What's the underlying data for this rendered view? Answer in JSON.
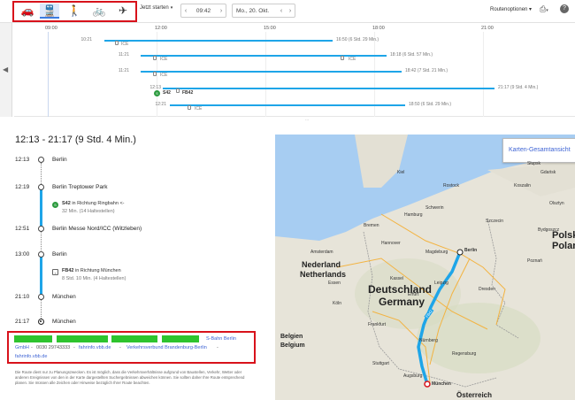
{
  "modes": [
    {
      "icon": "car-icon",
      "glyph": "🚗",
      "active": false
    },
    {
      "icon": "transit-icon",
      "glyph": "🚆",
      "active": true
    },
    {
      "icon": "walk-icon",
      "glyph": "🚶",
      "active": false
    },
    {
      "icon": "bicycle-icon",
      "glyph": "🚲",
      "active": false
    },
    {
      "icon": "flight-icon",
      "glyph": "✈",
      "active": false
    }
  ],
  "toolbar": {
    "depart_label": "Jetzt starten",
    "time_value": "09:42",
    "date_value": "Mo., 20. Okt.",
    "route_options": "Routenoptionen",
    "print_icon": "printer-icon",
    "help_icon": "help-icon"
  },
  "timeline": {
    "ticks": [
      "09:00",
      "12:00",
      "15:00",
      "18:00",
      "21:00"
    ],
    "trips": [
      {
        "start": "10:21",
        "end": "16:50 (6 Std. 29 Min.)",
        "label": "ICE"
      },
      {
        "start": "11:21",
        "end": "18:18 (6 Std. 57 Min.)",
        "label": "ICE"
      },
      {
        "start": "11:21",
        "end": "18:42 (7 Std. 21 Min.)",
        "label": "ICE"
      },
      {
        "start": "12:13",
        "end": "21:17 (9 Std. 4 Min.)",
        "label": "S42",
        "label2": "FB42"
      },
      {
        "start": "12:21",
        "end": "18:50 (6 Std. 29 Min.)",
        "label": "ICE"
      }
    ],
    "more": "..."
  },
  "itinerary": {
    "summary": "12:13 - 21:17 (9 Std. 4 Min.)",
    "stops": [
      {
        "time": "12:13",
        "name": "Berlin"
      },
      {
        "time": "12:19",
        "name": "Berlin Treptower Park"
      },
      {
        "time": "12:51",
        "name": "Berlin Messe Nord/ICC (Witzleben)"
      },
      {
        "time": "13:00",
        "name": "Berlin"
      },
      {
        "time": "21:10",
        "name": "München"
      },
      {
        "time": "21:17",
        "name": "München"
      }
    ],
    "legs": [
      {
        "line": "S42",
        "direction": "in Richtung Ringbahn <-",
        "detail": "32 Min. (14 Haltestellen)"
      },
      {
        "line": "FB42",
        "direction": "in Richtung München",
        "detail": "8 Std. 10 Min. (4 Haltestellen)"
      }
    ]
  },
  "operators": {
    "sbahn": "S-Bahn Berlin",
    "sbahn_gmbh": "GmbH",
    "sbahn_phone": "0030 29743333",
    "sbahn_site": "fahrinfo.vbb.de",
    "vbb": "Verkehrsverbund Brandenburg-Berlin",
    "vbb_site": "fahrinfo.vbb.de",
    "sep": "-"
  },
  "disclaimer": "Die Route dient nur zu Planungszwecken. Es ist möglich, dass die Verkehrsverhältnisse aufgrund von Baustellen, Verkehr, Wetter oder anderen Ereignissen von den in der Karte dargestellten Suchergebnissen abweichen können. Sie sollten daher Ihre Route entsprechend planen. Sie müssen alle Zeichen oder Hinweise bezüglich Ihrer Route beachten.",
  "map": {
    "overview_button": "Karten-Gesamtansicht",
    "countries": [
      "Nederland",
      "Netherlands",
      "Deutschland",
      "Germany",
      "Polska",
      "Poland",
      "Belgien",
      "Belgium",
      "Österreich"
    ],
    "cities": [
      "Berlin",
      "München",
      "Hamburg",
      "Hannover",
      "Bremen",
      "Leipzig",
      "Dresden",
      "Nürnberg",
      "Frankfurt",
      "Köln",
      "Stuttgart",
      "Szczecin",
      "Gdańsk",
      "Olsztyn",
      "Poznań",
      "Bydgoszcz",
      "Amsterdam",
      "Kiel",
      "Rostock",
      "Kassel",
      "Erfurt",
      "Magdeburg",
      "Essen",
      "Regensburg",
      "Augsburg",
      "Koszalin",
      "Słupsk",
      "Schwerin"
    ],
    "route_label": "FB42",
    "route_color": "#1ea5e8"
  }
}
